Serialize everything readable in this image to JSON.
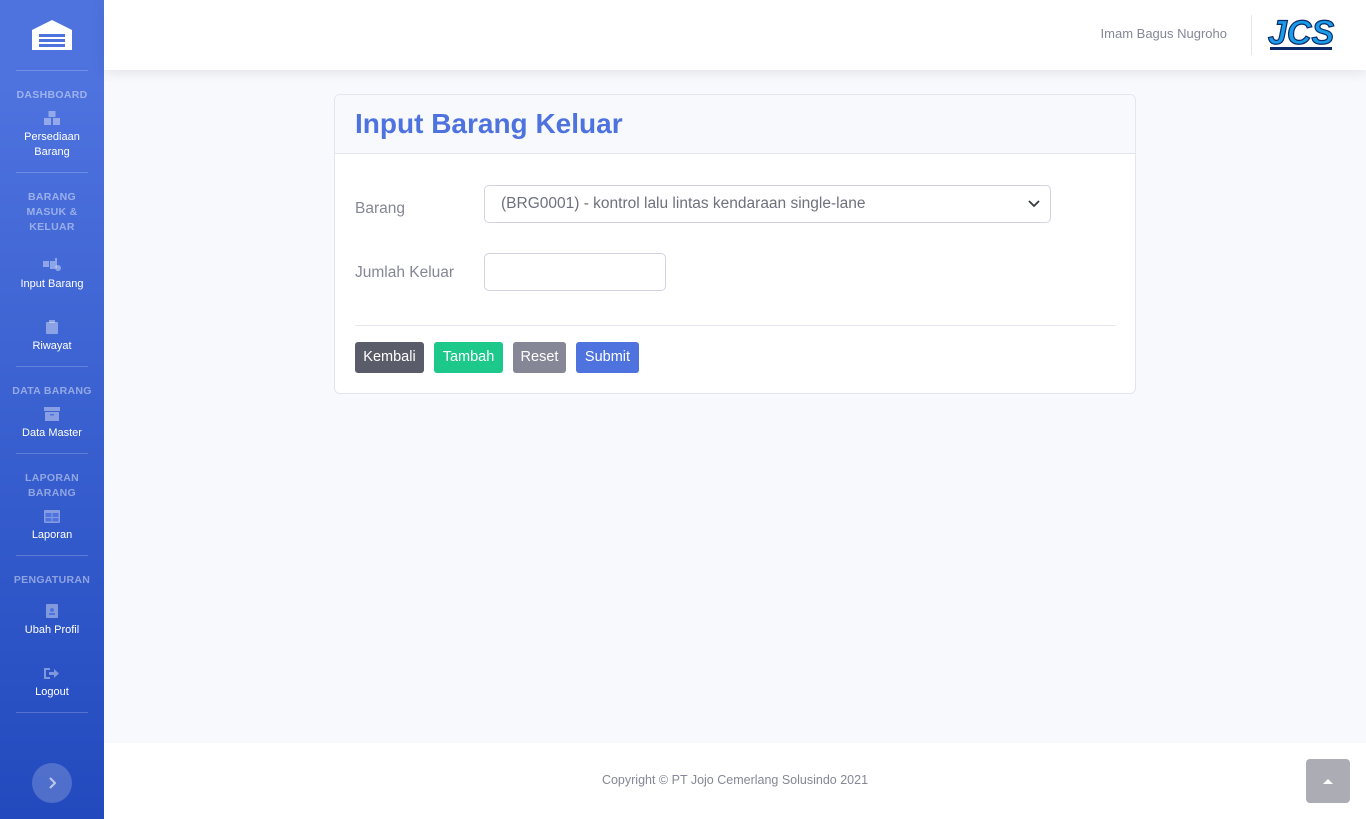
{
  "sidebar": {
    "sections": [
      {
        "heading": "DASHBOARD",
        "items": [
          {
            "label": "Persediaan Barang",
            "icon": "boxes-icon"
          }
        ]
      },
      {
        "heading": "BARANG MASUK & KELUAR",
        "items": [
          {
            "label": "Input Barang",
            "icon": "dolly-icon"
          },
          {
            "label": "Riwayat",
            "icon": "clipboard-icon"
          }
        ]
      },
      {
        "heading": "DATA BARANG",
        "items": [
          {
            "label": "Data Master",
            "icon": "archive-icon"
          }
        ]
      },
      {
        "heading": "LAPORAN BARANG",
        "items": [
          {
            "label": "Laporan",
            "icon": "table-icon"
          }
        ]
      },
      {
        "heading": "PENGATURAN",
        "items": [
          {
            "label": "Ubah Profil",
            "icon": "id-badge-icon"
          },
          {
            "label": "Logout",
            "icon": "sign-out-icon"
          }
        ]
      }
    ]
  },
  "topbar": {
    "user_name": "Imam Bagus Nugroho"
  },
  "card": {
    "title": "Input Barang Keluar",
    "barang_label": "Barang",
    "barang_selected": "(BRG0001) - kontrol lalu lintas kendaraan single-lane",
    "jumlah_label": "Jumlah Keluar",
    "jumlah_value": "",
    "buttons": {
      "kembali": "Kembali",
      "tambah": "Tambah",
      "reset": "Reset",
      "submit": "Submit"
    }
  },
  "footer": {
    "copyright": "Copyright © PT Jojo Cemerlang Solusindo 2021"
  },
  "colors": {
    "primary": "#4e73df",
    "success": "#1cc88a",
    "secondary": "#858796",
    "dark": "#5a5c69"
  }
}
